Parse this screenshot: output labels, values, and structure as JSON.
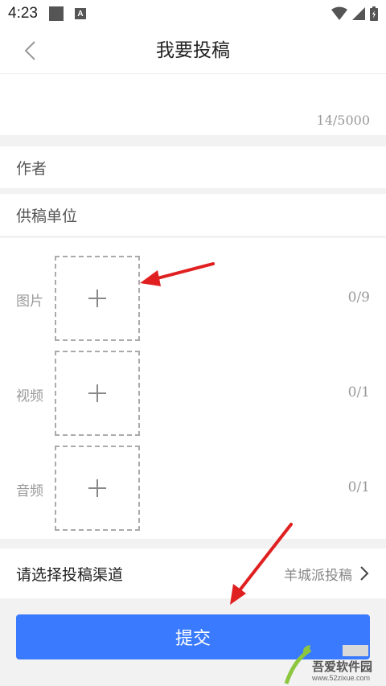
{
  "status_bar": {
    "time": "4:23",
    "notif_a": "A",
    "icons": [
      "notification-square-icon",
      "notification-a-icon",
      "wifi-icon",
      "signal-icon",
      "battery-icon"
    ]
  },
  "nav": {
    "title": "我要投稿",
    "back_icon": "chevron-left-icon"
  },
  "content": {
    "char_count": "14/5000"
  },
  "fields": {
    "author_label": "作者",
    "unit_label": "供稿单位"
  },
  "media": [
    {
      "label": "图片",
      "count": "0/9",
      "icon": "plus-icon"
    },
    {
      "label": "视频",
      "count": "0/1",
      "icon": "plus-icon"
    },
    {
      "label": "音频",
      "count": "0/1",
      "icon": "plus-icon"
    }
  ],
  "channel": {
    "label": "请选择投稿渠道",
    "value": "羊城派投稿",
    "icon": "chevron-right-icon"
  },
  "submit": {
    "label": "提交",
    "color": "#3a7afe"
  },
  "annotations": {
    "arrow_color": "#e02020"
  },
  "watermark": {
    "text": "吾爱软件园",
    "url": "www.52zixue.com"
  }
}
